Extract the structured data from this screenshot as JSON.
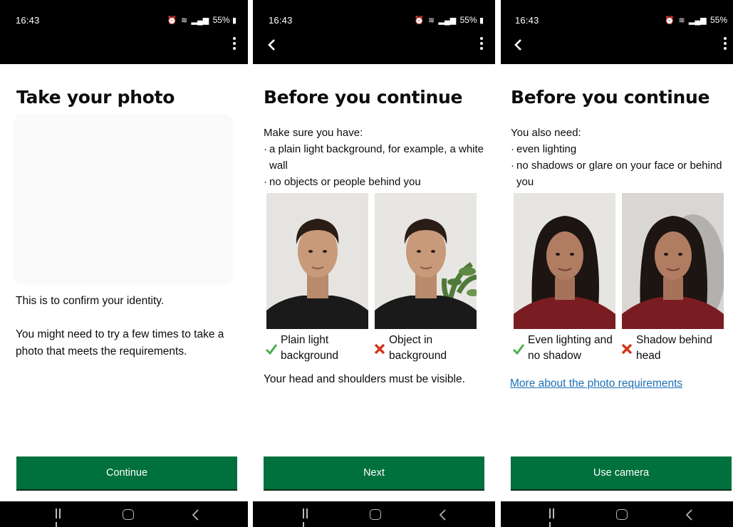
{
  "screens": [
    {
      "status": {
        "time": "16:43",
        "battery": "55%"
      },
      "title": "Take your photo",
      "paragraphs": [
        "This is to confirm your identity.",
        "You might need to try a few times to take a photo that meets the requirements."
      ],
      "button": "Continue"
    },
    {
      "status": {
        "time": "16:43",
        "battery": "55%"
      },
      "title": "Before you continue",
      "intro": "Make sure you have:",
      "bullets": [
        "a plain light background, for example, a white wall",
        "no objects or people behind you"
      ],
      "examples": [
        {
          "caption": "Plain light background",
          "status": "good"
        },
        {
          "caption": "Object in background",
          "status": "bad"
        }
      ],
      "note": "Your head and shoulders must be visible.",
      "button": "Next"
    },
    {
      "status": {
        "time": "16:43",
        "battery": "55%"
      },
      "title": "Before you continue",
      "intro": "You also need:",
      "bullets": [
        "even lighting",
        "no shadows or glare on your face or behind you"
      ],
      "examples": [
        {
          "caption": "Even lighting and no shadow",
          "status": "good"
        },
        {
          "caption": "Shadow behind head",
          "status": "bad"
        }
      ],
      "link": "More about the photo requirements",
      "button": "Use camera"
    }
  ],
  "colors": {
    "primary_button": "#00703c",
    "link": "#1d70b8",
    "good_tick": "#4caf50",
    "bad_cross": "#d4351c"
  }
}
